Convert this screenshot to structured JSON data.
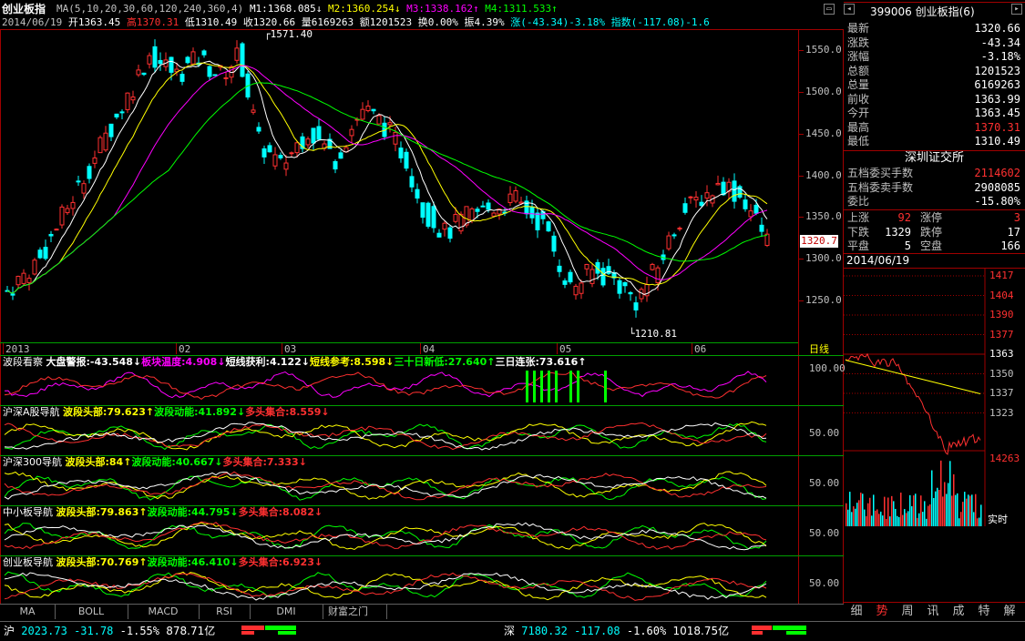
{
  "header": {
    "title": "创业板指",
    "ma_label": "MA(5,10,20,30,60,120,240,360,4)",
    "m1": "M1:1368.085",
    "m2": "M2:1360.254",
    "m3": "M3:1338.162",
    "m4": "M4:1311.533",
    "line2_date": "2014/06/19",
    "open": "开1363.45",
    "high": "高1370.31",
    "low": "低1310.49",
    "close": "收1320.66",
    "volume": "量6169263",
    "amount": "额1201523",
    "turnover": "换0.00%",
    "amplitude": "振4.39%",
    "change": "涨(-43.34)-3.18%",
    "index_points": "指数(-117.08)-1.6"
  },
  "main_chart": {
    "y_ticks": [
      "1550.0",
      "1500.0",
      "1450.0",
      "1400.0",
      "1350.0",
      "1300.0",
      "1250.0"
    ],
    "high_label": "1571.40",
    "low_label": "1210.81",
    "current_price_tag": "1320.7",
    "x_labels": [
      "2013",
      "02",
      "03",
      "04",
      "05",
      "06"
    ],
    "period_label": "日线"
  },
  "indicators": [
    {
      "name": "波段看察",
      "parts": [
        {
          "t": "大盘警报:-43.548↓",
          "c": "#ffffff"
        },
        {
          "t": "板块温度:4.908↓",
          "c": "#ff00ff"
        },
        {
          "t": "短线获利:4.122↓",
          "c": "#ffffff"
        },
        {
          "t": "短线参考:8.598↓",
          "c": "#ffff00"
        },
        {
          "t": "三十日新低:27.640↑",
          "c": "#00ff00"
        },
        {
          "t": "三日连张:73.616↑",
          "c": "#ffffff"
        }
      ],
      "scale": "100.00"
    },
    {
      "name": "沪深A股导航",
      "parts": [
        {
          "t": "波段头部:79.623↑",
          "c": "#ffff00"
        },
        {
          "t": "波段动能:41.892↓",
          "c": "#00ff00"
        },
        {
          "t": "多头集合:8.559↓",
          "c": "#ff3030"
        }
      ],
      "scale": "50.00"
    },
    {
      "name": "沪深300导航",
      "parts": [
        {
          "t": "波段头部:84↑",
          "c": "#ffff00"
        },
        {
          "t": "波段动能:40.667↓",
          "c": "#00ff00"
        },
        {
          "t": "多头集合:7.333↓",
          "c": "#ff3030"
        }
      ],
      "scale": "50.00"
    },
    {
      "name": "中小板导航",
      "parts": [
        {
          "t": "波段头部:79.863↑",
          "c": "#ffff00"
        },
        {
          "t": "波段动能:44.795↓",
          "c": "#00ff00"
        },
        {
          "t": "多头集合:8.082↓",
          "c": "#ff3030"
        }
      ],
      "scale": "50.00"
    },
    {
      "name": "创业板导航",
      "parts": [
        {
          "t": "波段头部:70.769↑",
          "c": "#ffff00"
        },
        {
          "t": "波段动能:46.410↓",
          "c": "#00ff00"
        },
        {
          "t": "多头集合:6.923↓",
          "c": "#ff3030"
        }
      ],
      "scale": "50.00"
    }
  ],
  "bottom_tabs": [
    "MA",
    "BOLL",
    "MACD",
    "RSI",
    "DMI",
    "财富之门"
  ],
  "right_panel": {
    "code_title": "399006 创业板指(6)",
    "quotes": [
      {
        "k": "最新",
        "v": "1320.66",
        "c": "#ffffff"
      },
      {
        "k": "涨跌",
        "v": "-43.34",
        "c": "#ffffff"
      },
      {
        "k": "涨幅",
        "v": "-3.18%",
        "c": "#ffffff"
      },
      {
        "k": "总额",
        "v": "1201523",
        "c": "#ffffff"
      },
      {
        "k": "总量",
        "v": "6169263",
        "c": "#ffffff"
      },
      {
        "k": "前收",
        "v": "1363.99",
        "c": "#ffffff"
      },
      {
        "k": "今开",
        "v": "1363.45",
        "c": "#ffffff"
      },
      {
        "k": "最高",
        "v": "1370.31",
        "c": "#ff3030"
      },
      {
        "k": "最低",
        "v": "1310.49",
        "c": "#ffffff"
      }
    ],
    "exchange": "深圳证交所",
    "orders": [
      {
        "k": "五档委买手数",
        "v": "2114602",
        "c": "#ff3030"
      },
      {
        "k": "五档委卖手数",
        "v": "2908085",
        "c": "#ffffff"
      },
      {
        "k": "委比",
        "v": "-15.80%",
        "c": "#ffffff"
      }
    ],
    "breadth": [
      {
        "k1": "上涨",
        "v1": "92",
        "c1": "#ff3030",
        "k2": "涨停",
        "v2": "3",
        "c2": "#ff3030"
      },
      {
        "k1": "下跌",
        "v1": "1329",
        "c1": "#ffffff",
        "k2": "跌停",
        "v2": "17",
        "c2": "#ffffff"
      },
      {
        "k1": "平盘",
        "v1": "5",
        "c1": "#ffffff",
        "k2": "空盘",
        "v2": "166",
        "c2": "#ffffff"
      }
    ],
    "mini_date": "2014/06/19",
    "mini_ticks": [
      "1417",
      "1404",
      "1390",
      "1377",
      "1363",
      "1350",
      "1337",
      "1323"
    ],
    "mini_vol_tick": "14263",
    "mini_realtime": "实时",
    "tabs": [
      "细",
      "势",
      "周",
      "讯",
      "成",
      "特",
      "解"
    ]
  },
  "status_bar": {
    "sh_label": "沪",
    "sh_value": "2023.73",
    "sh_change": "-31.78",
    "sh_pct": "-1.55%",
    "sh_amount": "878.71亿",
    "sz_label": "深",
    "sz_value": "7180.32",
    "sz_change": "-117.08",
    "sz_pct": "-1.60%",
    "sz_amount": "1018.75亿"
  },
  "colors": {
    "up": "#ff3030",
    "down": "#00ffff",
    "ma5": "#ffffff",
    "ma10": "#ffff00",
    "ma20": "#ff00ff",
    "ma30": "#00ff00",
    "grid": "#a00000"
  }
}
